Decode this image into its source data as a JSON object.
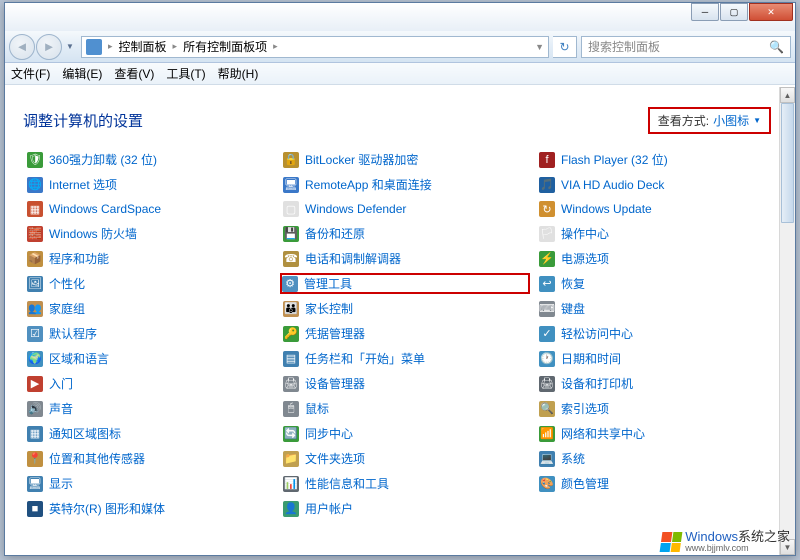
{
  "breadcrumb": {
    "root": "控制面板",
    "sub": "所有控制面板项"
  },
  "search": {
    "placeholder": "搜索控制面板"
  },
  "menu": {
    "file": "文件(F)",
    "edit": "编辑(E)",
    "view": "查看(V)",
    "tools": "工具(T)",
    "help": "帮助(H)"
  },
  "heading": "调整计算机的设置",
  "view_by": {
    "label": "查看方式:",
    "value": "小图标"
  },
  "items": [
    {
      "name": "360强力卸载 (32 位)",
      "icon": "🛡",
      "bg": "#3a9b3a",
      "hl": false
    },
    {
      "name": "BitLocker 驱动器加密",
      "icon": "🔒",
      "bg": "#b8902e",
      "hl": false
    },
    {
      "name": "Flash Player (32 位)",
      "icon": "f",
      "bg": "#a02020",
      "hl": false
    },
    {
      "name": "Internet 选项",
      "icon": "🌐",
      "bg": "#3a78c8",
      "hl": false
    },
    {
      "name": "RemoteApp 和桌面连接",
      "icon": "🖥",
      "bg": "#3a78c8",
      "hl": false
    },
    {
      "name": "VIA HD Audio Deck",
      "icon": "🎵",
      "bg": "#2060a0",
      "hl": false
    },
    {
      "name": "Windows CardSpace",
      "icon": "▦",
      "bg": "#c85030",
      "hl": false
    },
    {
      "name": "Windows Defender",
      "icon": "▢",
      "bg": "#e0e0e0",
      "hl": false
    },
    {
      "name": "Windows Update",
      "icon": "↻",
      "bg": "#d09030",
      "hl": false
    },
    {
      "name": "Windows 防火墙",
      "icon": "🧱",
      "bg": "#c04030",
      "hl": false
    },
    {
      "name": "备份和还原",
      "icon": "💾",
      "bg": "#3a9b3a",
      "hl": false
    },
    {
      "name": "操作中心",
      "icon": "🏳",
      "bg": "#e0e0e0",
      "hl": false
    },
    {
      "name": "程序和功能",
      "icon": "📦",
      "bg": "#c09040",
      "hl": false
    },
    {
      "name": "电话和调制解调器",
      "icon": "☎",
      "bg": "#b09040",
      "hl": false
    },
    {
      "name": "电源选项",
      "icon": "⚡",
      "bg": "#3a9b3a",
      "hl": false
    },
    {
      "name": "个性化",
      "icon": "🖼",
      "bg": "#4080b0",
      "hl": false
    },
    {
      "name": "管理工具",
      "icon": "⚙",
      "bg": "#5090c0",
      "hl": true
    },
    {
      "name": "恢复",
      "icon": "↩",
      "bg": "#4090c0",
      "hl": false
    },
    {
      "name": "家庭组",
      "icon": "👥",
      "bg": "#c09050",
      "hl": false
    },
    {
      "name": "家长控制",
      "icon": "👪",
      "bg": "#c09050",
      "hl": false
    },
    {
      "name": "键盘",
      "icon": "⌨",
      "bg": "#808890",
      "hl": false
    },
    {
      "name": "默认程序",
      "icon": "☑",
      "bg": "#5090c0",
      "hl": false
    },
    {
      "name": "凭据管理器",
      "icon": "🔑",
      "bg": "#3a9b3a",
      "hl": false
    },
    {
      "name": "轻松访问中心",
      "icon": "✓",
      "bg": "#4090c0",
      "hl": false
    },
    {
      "name": "区域和语言",
      "icon": "🌍",
      "bg": "#4090c0",
      "hl": false
    },
    {
      "name": "任务栏和「开始」菜单",
      "icon": "▤",
      "bg": "#4080b0",
      "hl": false
    },
    {
      "name": "日期和时间",
      "icon": "🕐",
      "bg": "#4090c0",
      "hl": false
    },
    {
      "name": "入门",
      "icon": "▶",
      "bg": "#c04030",
      "hl": false
    },
    {
      "name": "设备管理器",
      "icon": "🖨",
      "bg": "#808890",
      "hl": false
    },
    {
      "name": "设备和打印机",
      "icon": "🖨",
      "bg": "#606870",
      "hl": false
    },
    {
      "name": "声音",
      "icon": "🔊",
      "bg": "#808890",
      "hl": false
    },
    {
      "name": "鼠标",
      "icon": "🖱",
      "bg": "#808890",
      "hl": false
    },
    {
      "name": "索引选项",
      "icon": "🔍",
      "bg": "#c0a050",
      "hl": false
    },
    {
      "name": "通知区域图标",
      "icon": "▦",
      "bg": "#4080b0",
      "hl": false
    },
    {
      "name": "同步中心",
      "icon": "🔄",
      "bg": "#3a9b3a",
      "hl": false
    },
    {
      "name": "网络和共享中心",
      "icon": "📶",
      "bg": "#3a9b3a",
      "hl": false
    },
    {
      "name": "位置和其他传感器",
      "icon": "📍",
      "bg": "#c09040",
      "hl": false
    },
    {
      "name": "文件夹选项",
      "icon": "📁",
      "bg": "#c0a050",
      "hl": false
    },
    {
      "name": "系统",
      "icon": "💻",
      "bg": "#4080b0",
      "hl": false
    },
    {
      "name": "显示",
      "icon": "🖥",
      "bg": "#4080b0",
      "hl": false
    },
    {
      "name": "性能信息和工具",
      "icon": "📊",
      "bg": "#606870",
      "hl": false
    },
    {
      "name": "颜色管理",
      "icon": "🎨",
      "bg": "#4090c0",
      "hl": false
    },
    {
      "name": "英特尔(R) 图形和媒体",
      "icon": "■",
      "bg": "#205080",
      "hl": false
    },
    {
      "name": "用户帐户",
      "icon": "👤",
      "bg": "#3a9b70",
      "hl": false
    }
  ],
  "watermark": {
    "line1a": "Windows",
    "line1b": "系统之家",
    "line2": "www.bjjmlv.com"
  }
}
